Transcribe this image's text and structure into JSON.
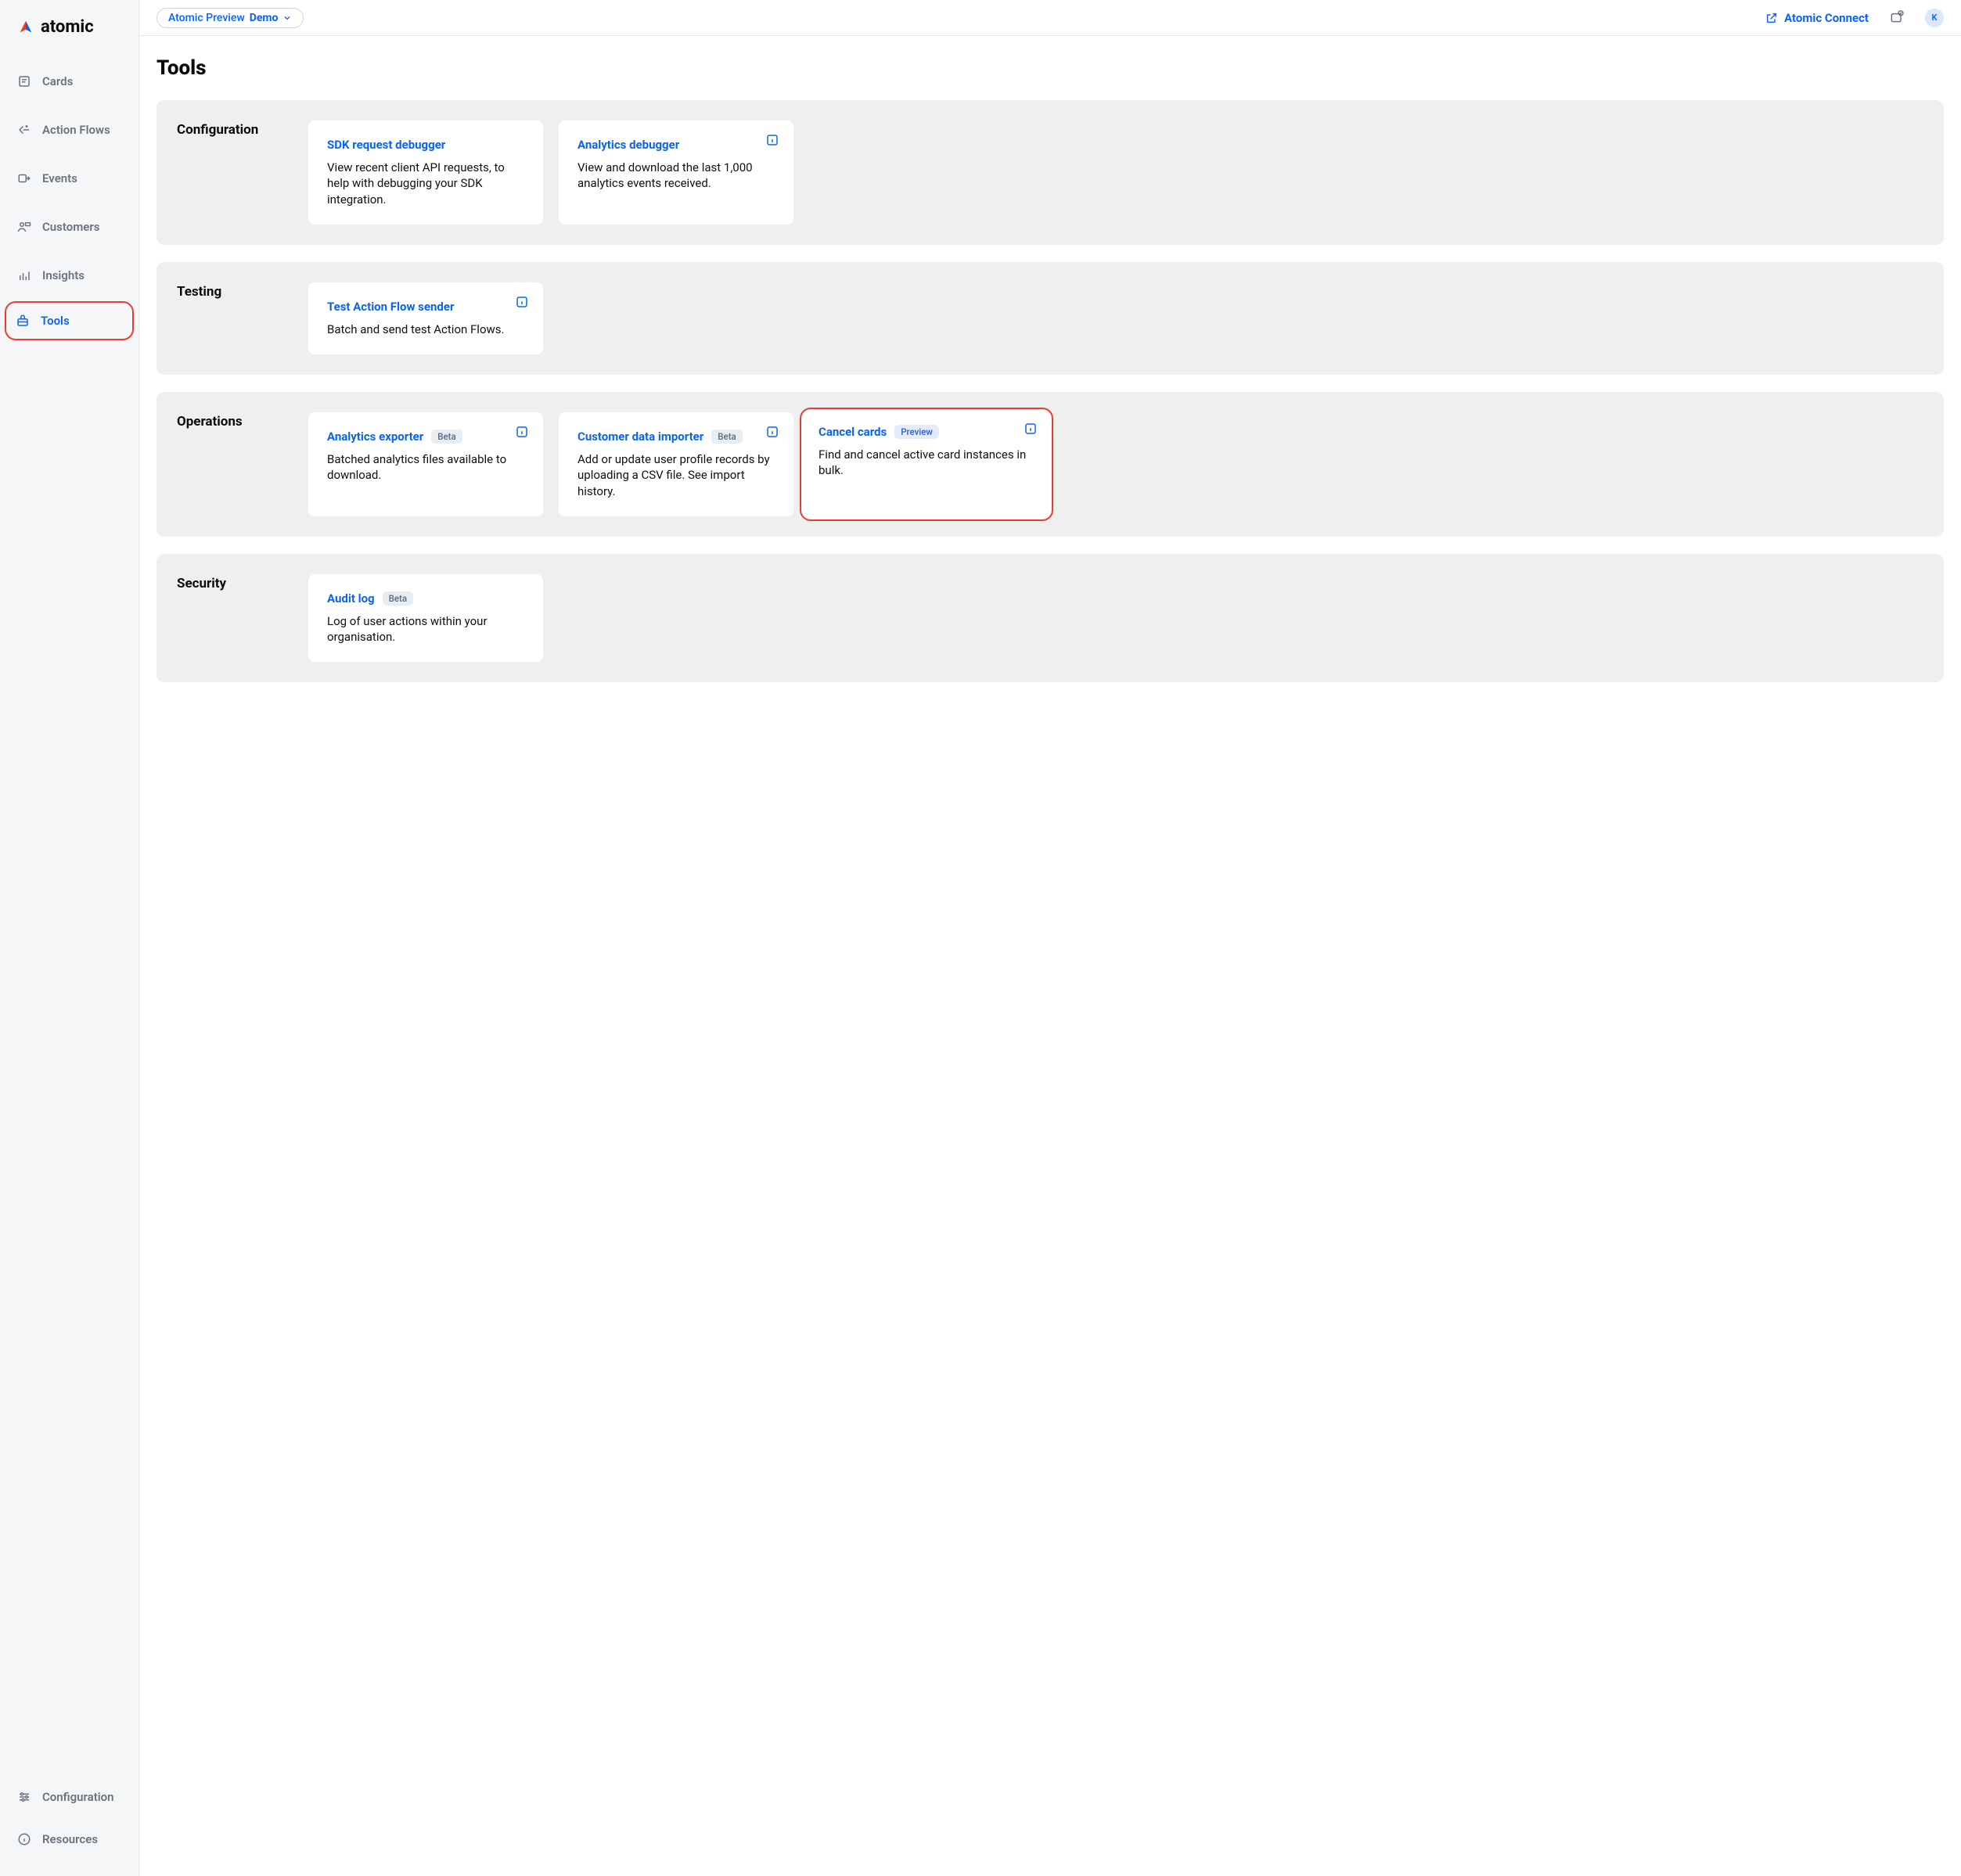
{
  "brand": "atomic",
  "header": {
    "env_prefix": "Atomic Preview ",
    "env_name": "Demo",
    "connect_label": "Atomic Connect",
    "avatar_initial": "K"
  },
  "sidebar": {
    "items": [
      {
        "id": "cards",
        "label": "Cards"
      },
      {
        "id": "action-flows",
        "label": "Action Flows"
      },
      {
        "id": "events",
        "label": "Events"
      },
      {
        "id": "customers",
        "label": "Customers"
      },
      {
        "id": "insights",
        "label": "Insights"
      },
      {
        "id": "tools",
        "label": "Tools"
      }
    ],
    "bottom": [
      {
        "id": "configuration",
        "label": "Configuration"
      },
      {
        "id": "resources",
        "label": "Resources"
      }
    ]
  },
  "page": {
    "title": "Tools"
  },
  "sections": {
    "configuration": {
      "heading": "Configuration",
      "cards": {
        "sdk": {
          "title": "SDK request debugger",
          "desc": "View recent client API requests, to help with debugging your SDK integration."
        },
        "analytics": {
          "title": "Analytics debugger",
          "desc": "View and download the last 1,000 analytics events received."
        }
      }
    },
    "testing": {
      "heading": "Testing",
      "cards": {
        "tafs": {
          "title": "Test Action Flow sender",
          "desc": "Batch and send test Action Flows."
        }
      }
    },
    "operations": {
      "heading": "Operations",
      "cards": {
        "exporter": {
          "title": "Analytics exporter",
          "badge": "Beta",
          "desc": "Batched analytics files available to download."
        },
        "importer": {
          "title": "Customer data importer",
          "badge": "Beta",
          "desc": "Add or update user profile records by uploading a CSV file. See import history."
        },
        "cancel": {
          "title": "Cancel cards",
          "badge": "Preview",
          "desc": "Find and cancel active card instances in bulk."
        }
      }
    },
    "security": {
      "heading": "Security",
      "cards": {
        "audit": {
          "title": "Audit log",
          "badge": "Beta",
          "desc": "Log of user actions within your organisation."
        }
      }
    }
  }
}
